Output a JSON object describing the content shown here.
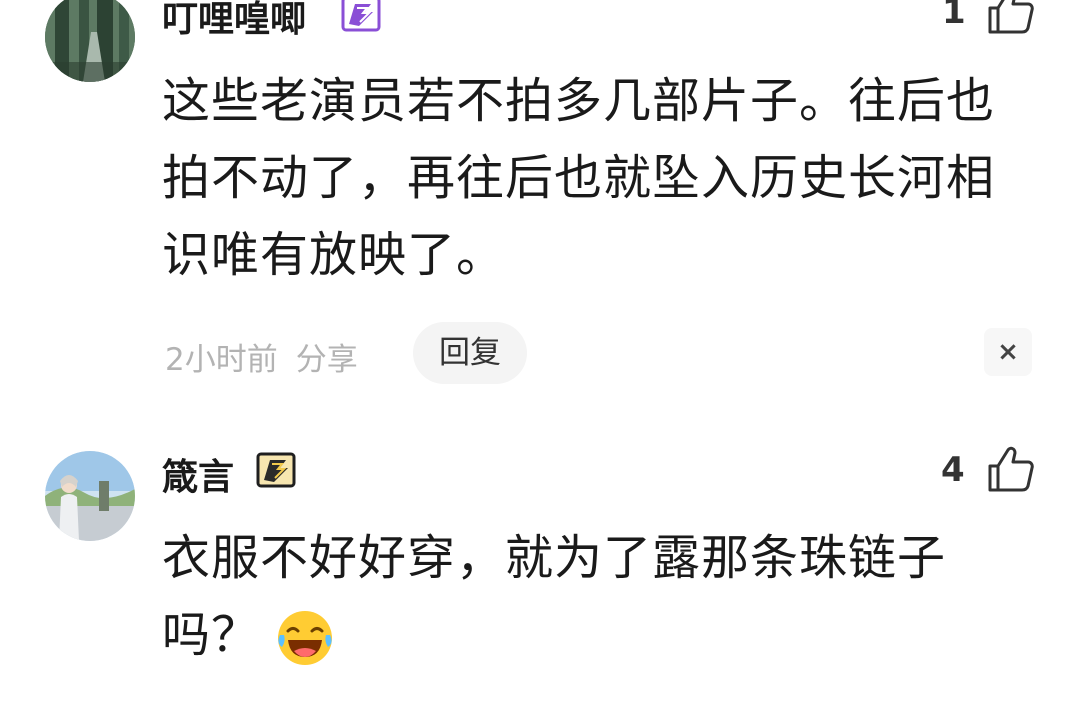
{
  "comments": [
    {
      "username": "叮哩喤唧",
      "badge_color": "#8a4fd6",
      "likes": "1",
      "text_lines": [
        "这些老演员若不拍多几部片子。往后也",
        "拍不动了，再往后也就坠入历史长河相",
        "识唯有放映了。"
      ],
      "time": "2小时前",
      "share_label": "分享",
      "reply_label": "回复",
      "close_label": "×"
    },
    {
      "username": "箴言",
      "badge_color": "#c89a2a",
      "likes": "4",
      "text_lines": [
        "衣服不好好穿，就为了露那条珠链子",
        "吗？"
      ],
      "emoji": "laughing-tears-emoji"
    }
  ]
}
